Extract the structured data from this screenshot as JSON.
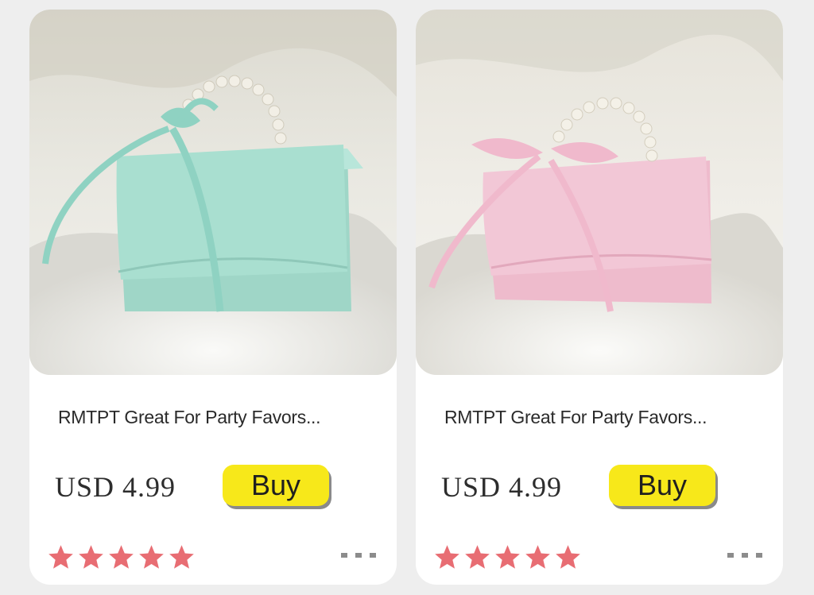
{
  "products": [
    {
      "image_alt": "mint gift box",
      "title": "RMTPT Great For Party Favors...",
      "price": "USD 4.99",
      "buy_label": "Buy",
      "rating": 5,
      "box_color": "#a9dfd0",
      "ribbon_color": "#8fd2c2",
      "more_icon": "ellipsis-icon"
    },
    {
      "image_alt": "pink gift box",
      "title": "RMTPT Great For Party Favors...",
      "price": "USD 4.99",
      "buy_label": "Buy",
      "rating": 5,
      "box_color": "#f2c7d6",
      "ribbon_color": "#f0b9cc",
      "more_icon": "ellipsis-icon"
    }
  ],
  "colors": {
    "star": "#e86d73",
    "buy_button": "#f7e81a",
    "more_dots": "#8c8c8c",
    "card_bg": "#ffffff",
    "page_bg": "#eeeeee"
  }
}
